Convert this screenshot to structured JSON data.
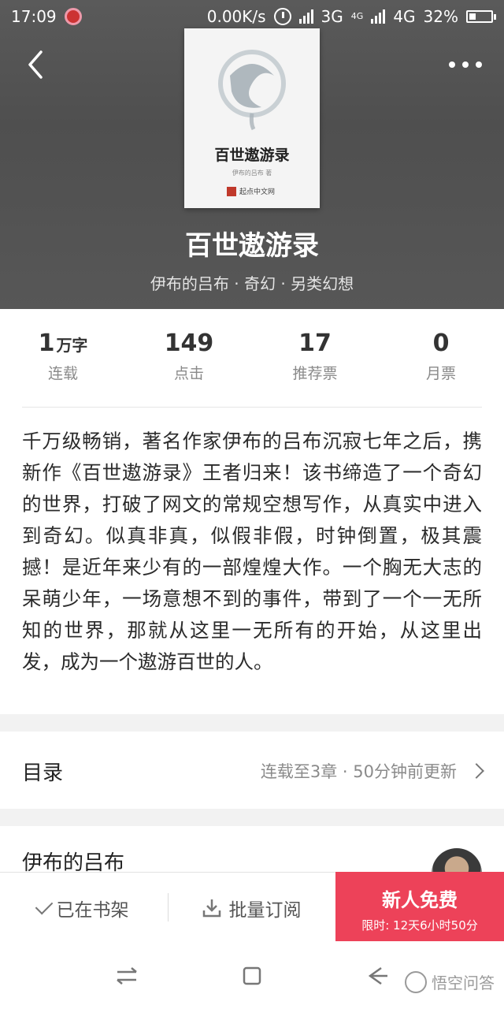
{
  "status_bar": {
    "time": "17:09",
    "speed": "0.00K/s",
    "net1": "3G",
    "net2_small": "4G",
    "net3": "4G",
    "battery": "32%"
  },
  "icons": {
    "back": "chevron-left-icon",
    "more": "more-dots-icon",
    "check": "check-icon",
    "download": "download-icon",
    "chevron_right": "chevron-right-icon"
  },
  "cover": {
    "title": "百世遨游录",
    "author_line": "伊布的吕布 著",
    "publisher": "起点中文网"
  },
  "book": {
    "title": "百世遨游录",
    "meta": "伊布的吕布 · 奇幻 · 另类幻想"
  },
  "stats": [
    {
      "value": "1",
      "unit": "万字",
      "label": "连载"
    },
    {
      "value": "149",
      "unit": "",
      "label": "点击"
    },
    {
      "value": "17",
      "unit": "",
      "label": "推荐票"
    },
    {
      "value": "0",
      "unit": "",
      "label": "月票"
    }
  ],
  "description": "千万级畅销，著名作家伊布的吕布沉寂七年之后，携新作《百世遨游录》王者归来！该书缔造了一个奇幻的世界，打破了网文的常规空想写作，从真实中进入到奇幻。似真非真，似假非假，时钟倒置，极其震撼！是近年来少有的一部煌煌大作。一个胸无大志的呆萌少年，一场意想不到的事件，带到了一个一无所知的世界，那就从这里一无所有的开始，从这里出发，成为一个遨游百世的人。",
  "toc": {
    "title": "目录",
    "info": "连载至3章 · 50分钟前更新"
  },
  "author": {
    "name": "伊布的吕布"
  },
  "actions": {
    "shelf": "已在书架",
    "batch": "批量订阅",
    "cta_title": "新人免费",
    "cta_sub": "限时: 12天6小时50分"
  },
  "watermark": "悟空问答",
  "colors": {
    "accent": "#ed4259",
    "header_bg": "#555555"
  }
}
